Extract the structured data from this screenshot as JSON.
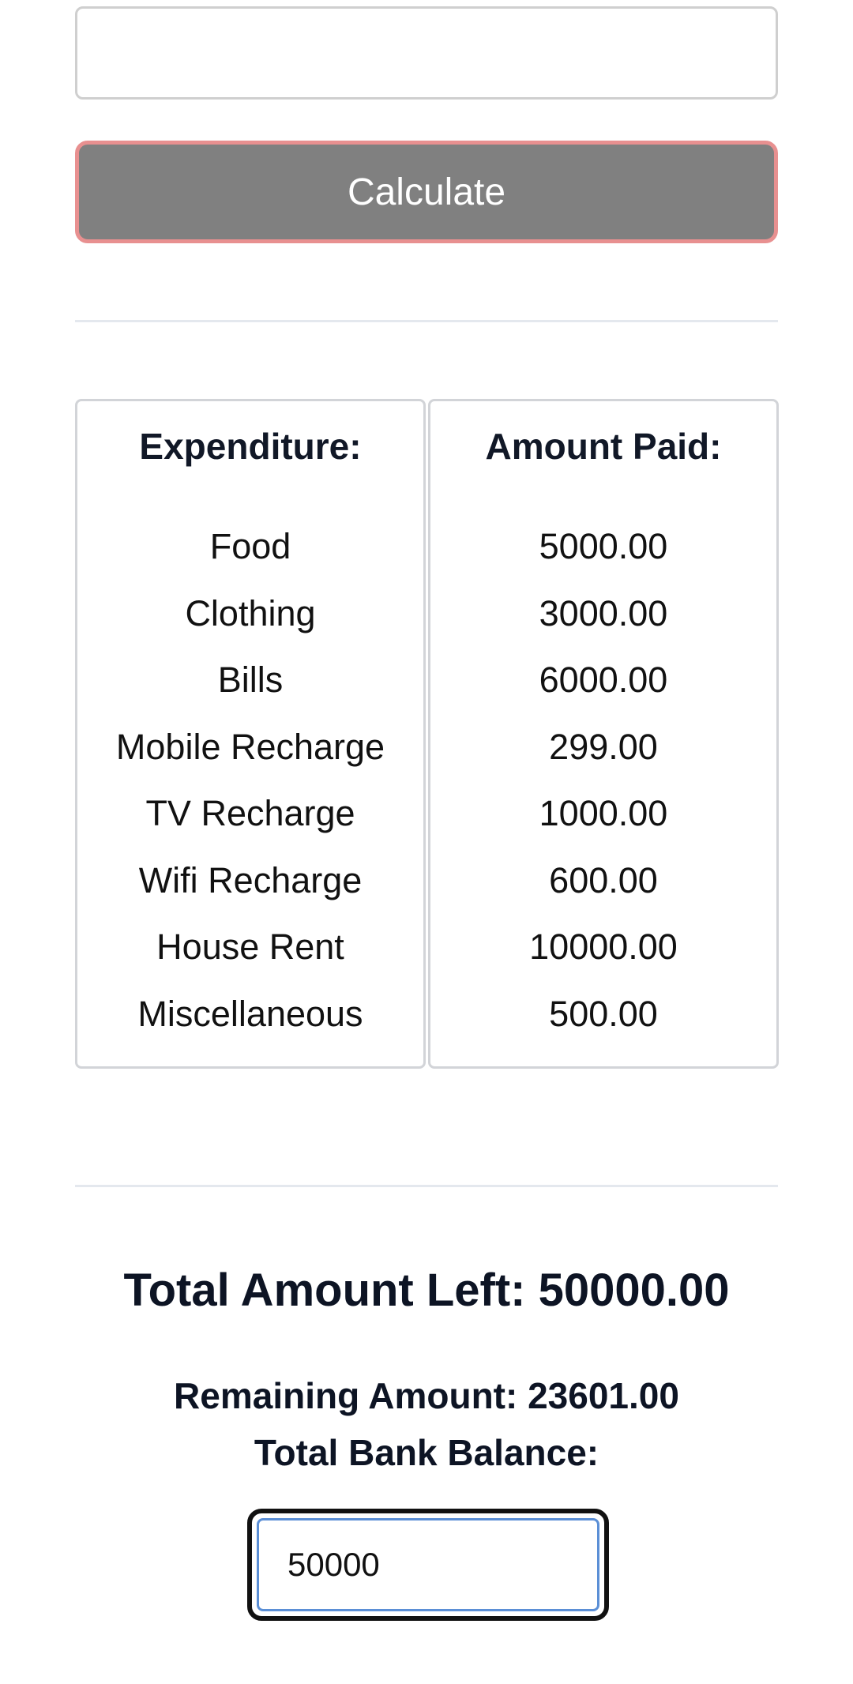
{
  "form": {
    "top_input_value": "",
    "calculate_label": "Calculate"
  },
  "table": {
    "expenditure_header": "Expenditure:",
    "amount_header": "Amount Paid:",
    "rows": [
      {
        "name": "Food",
        "amount": "5000.00"
      },
      {
        "name": "Clothing",
        "amount": "3000.00"
      },
      {
        "name": "Bills",
        "amount": "6000.00"
      },
      {
        "name": "Mobile Recharge",
        "amount": "299.00"
      },
      {
        "name": "TV Recharge",
        "amount": "1000.00"
      },
      {
        "name": "Wifi Recharge",
        "amount": "600.00"
      },
      {
        "name": "House Rent",
        "amount": "10000.00"
      },
      {
        "name": "Miscellaneous",
        "amount": "500.00"
      }
    ]
  },
  "summary": {
    "total_amount_left": "Total Amount Left: 50000.00",
    "remaining_amount": "Remaining Amount: 23601.00",
    "total_bank_balance_label": "Total Bank Balance:",
    "bank_balance_value": "50000"
  },
  "colors": {
    "button_bg": "#808080",
    "button_border": "#e89090",
    "input_focus_border": "#5b8fd6"
  }
}
